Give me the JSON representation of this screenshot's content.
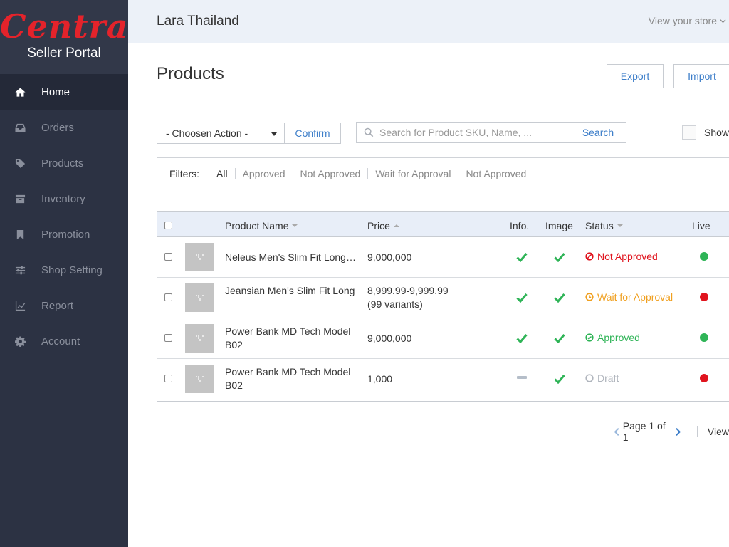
{
  "sidebar": {
    "logo_main": "Central",
    "logo_sub": "Seller Portal",
    "items": [
      {
        "label": "Home",
        "icon": "home-icon",
        "active": true
      },
      {
        "label": "Orders",
        "icon": "inbox-icon"
      },
      {
        "label": "Products",
        "icon": "tag-icon"
      },
      {
        "label": "Inventory",
        "icon": "archive-icon"
      },
      {
        "label": "Promotion",
        "icon": "bookmark-icon"
      },
      {
        "label": "Shop Setting",
        "icon": "sliders-icon"
      },
      {
        "label": "Report",
        "icon": "chart-icon"
      },
      {
        "label": "Account",
        "icon": "gear-icon"
      }
    ]
  },
  "header": {
    "store_name": "Lara Thailand",
    "view_store": "View your store"
  },
  "main": {
    "title": "Products",
    "export_label": "Export",
    "import_label": "Import",
    "action_select_value": "- Choosen Action -",
    "confirm_label": "Confirm",
    "search_placeholder": "Search for Product SKU, Name, ...",
    "search_label": "Search",
    "show_label": "Show",
    "filters_label": "Filters:",
    "filters": [
      "All",
      "Approved",
      "Not Approved",
      "Wait for Approval",
      "Not Approved"
    ]
  },
  "table": {
    "columns": {
      "name": "Product Name",
      "price": "Price",
      "info": "Info.",
      "image": "Image",
      "status": "Status",
      "live": "Live"
    },
    "rows": [
      {
        "name": "Neleus Men's Slim Fit Long…",
        "price": "9,000,000",
        "info": "check",
        "image": "check",
        "status": "Not Approved",
        "status_icon": "ban-icon",
        "live": "green"
      },
      {
        "name": "Jeansian Men's Slim Fit Long",
        "price": "8,999.99-9,999.99 (99 variants)",
        "info": "check",
        "image": "check",
        "status": "Wait for Approval",
        "status_icon": "clock-icon",
        "live": "red"
      },
      {
        "name": "Power Bank MD Tech Model B02",
        "price": "9,000,000",
        "info": "check",
        "image": "check",
        "status": "Approved",
        "status_icon": "check-circle-icon",
        "live": "green"
      },
      {
        "name": "Power Bank MD Tech Model B02",
        "price": "1,000",
        "info": "dash",
        "image": "check",
        "status": "Draft",
        "status_icon": "circle-icon",
        "live": "red"
      }
    ]
  },
  "pagination": {
    "label": "Page 1 of 1",
    "view_label": "View"
  },
  "colors": {
    "sidebar_bg": "#2c3243",
    "brand_red": "#e4232b",
    "link_blue": "#3d7ec9",
    "success_green": "#2fb457",
    "danger_red": "#e0141e",
    "warning_orange": "#f0a020",
    "muted_gray": "#b0b5bd"
  }
}
